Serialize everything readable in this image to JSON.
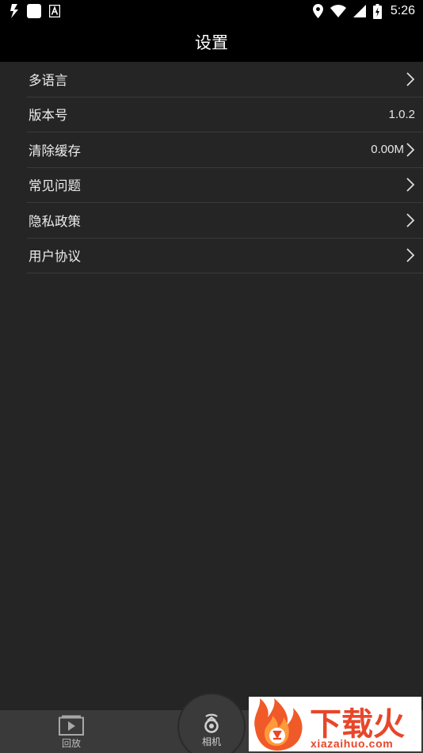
{
  "status_bar": {
    "time": "5:26",
    "icons": [
      "flash-icon",
      "app-square-icon",
      "text-a-icon",
      "location-icon",
      "wifi-icon",
      "signal-icon",
      "battery-charging-icon"
    ]
  },
  "header": {
    "title": "设置"
  },
  "settings": {
    "items": [
      {
        "label": "多语言",
        "value": "",
        "chevron": true
      },
      {
        "label": "版本号",
        "value": "1.0.2",
        "chevron": false
      },
      {
        "label": "清除缓存",
        "value": "0.00M",
        "chevron": true
      },
      {
        "label": "常见问题",
        "value": "",
        "chevron": true
      },
      {
        "label": "隐私政策",
        "value": "",
        "chevron": true
      },
      {
        "label": "用户协议",
        "value": "",
        "chevron": true
      }
    ]
  },
  "bottom_nav": {
    "playback_label": "回放",
    "camera_label": "相机"
  },
  "watermark": {
    "main": "下载火",
    "sub": "xiazaihuo.com"
  },
  "colors": {
    "background": "#252525",
    "header": "#000000",
    "nav": "#3a3a3a",
    "watermark_accent": "#e8462a"
  }
}
